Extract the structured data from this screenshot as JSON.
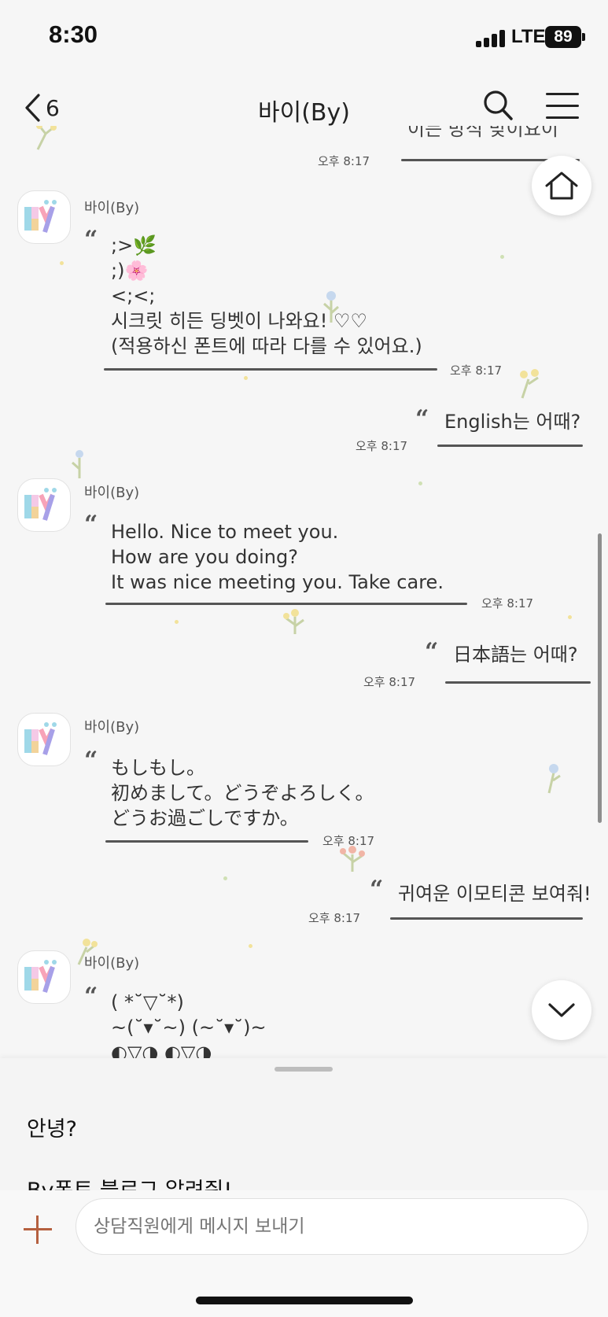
{
  "status_bar": {
    "time": "8:30",
    "network": "LTE",
    "battery": "89"
  },
  "header": {
    "back_count": "6",
    "title": "바이(By)"
  },
  "chat": {
    "prev_tail": {
      "text": "이든 방식 맞이요이",
      "time": "오후 8:17"
    },
    "messages": [
      {
        "side": "bot",
        "sender": "바이(By)",
        "avatar_text": "By",
        "lines": [
          ";>🌿",
          ";)🌸",
          "<;<;",
          "시크릿 히든 딩벳이 나와요! ♡♡",
          "(적용하신 폰트에 따라 다를 수 있어요.)"
        ],
        "time": "오후 8:17"
      },
      {
        "side": "user",
        "text": "English는 어때?",
        "time": "오후 8:17"
      },
      {
        "side": "bot",
        "sender": "바이(By)",
        "avatar_text": "By",
        "lines": [
          "Hello. Nice to meet you.",
          "How are you doing?",
          "It was nice meeting you. Take care."
        ],
        "time": "오후 8:17"
      },
      {
        "side": "user",
        "text": "日本語는 어때?",
        "time": "오후 8:17"
      },
      {
        "side": "bot",
        "sender": "바이(By)",
        "avatar_text": "By",
        "lines": [
          "もしもし。",
          "初めまして。どうぞよろしく。",
          "どうお過ごしですか。"
        ],
        "time": "오후 8:17"
      },
      {
        "side": "user",
        "text": "귀여운 이모티콘 보여줘!",
        "time": "오후 8:17"
      },
      {
        "side": "bot",
        "sender": "바이(By)",
        "avatar_text": "By",
        "lines": [
          "( *˘▽˘*)",
          "~(˘▾˘~) (~˘▾˘)~",
          "◐▽◑  ◐▽◑"
        ]
      }
    ]
  },
  "quick_replies": [
    "안녕?",
    "By폰트 블로그 알려줘!"
  ],
  "input": {
    "placeholder": "상담직원에게 메시지 보내기"
  },
  "colors": {
    "accent": "#b5603f",
    "underline": "#555555",
    "background": "#f6f6f6"
  }
}
